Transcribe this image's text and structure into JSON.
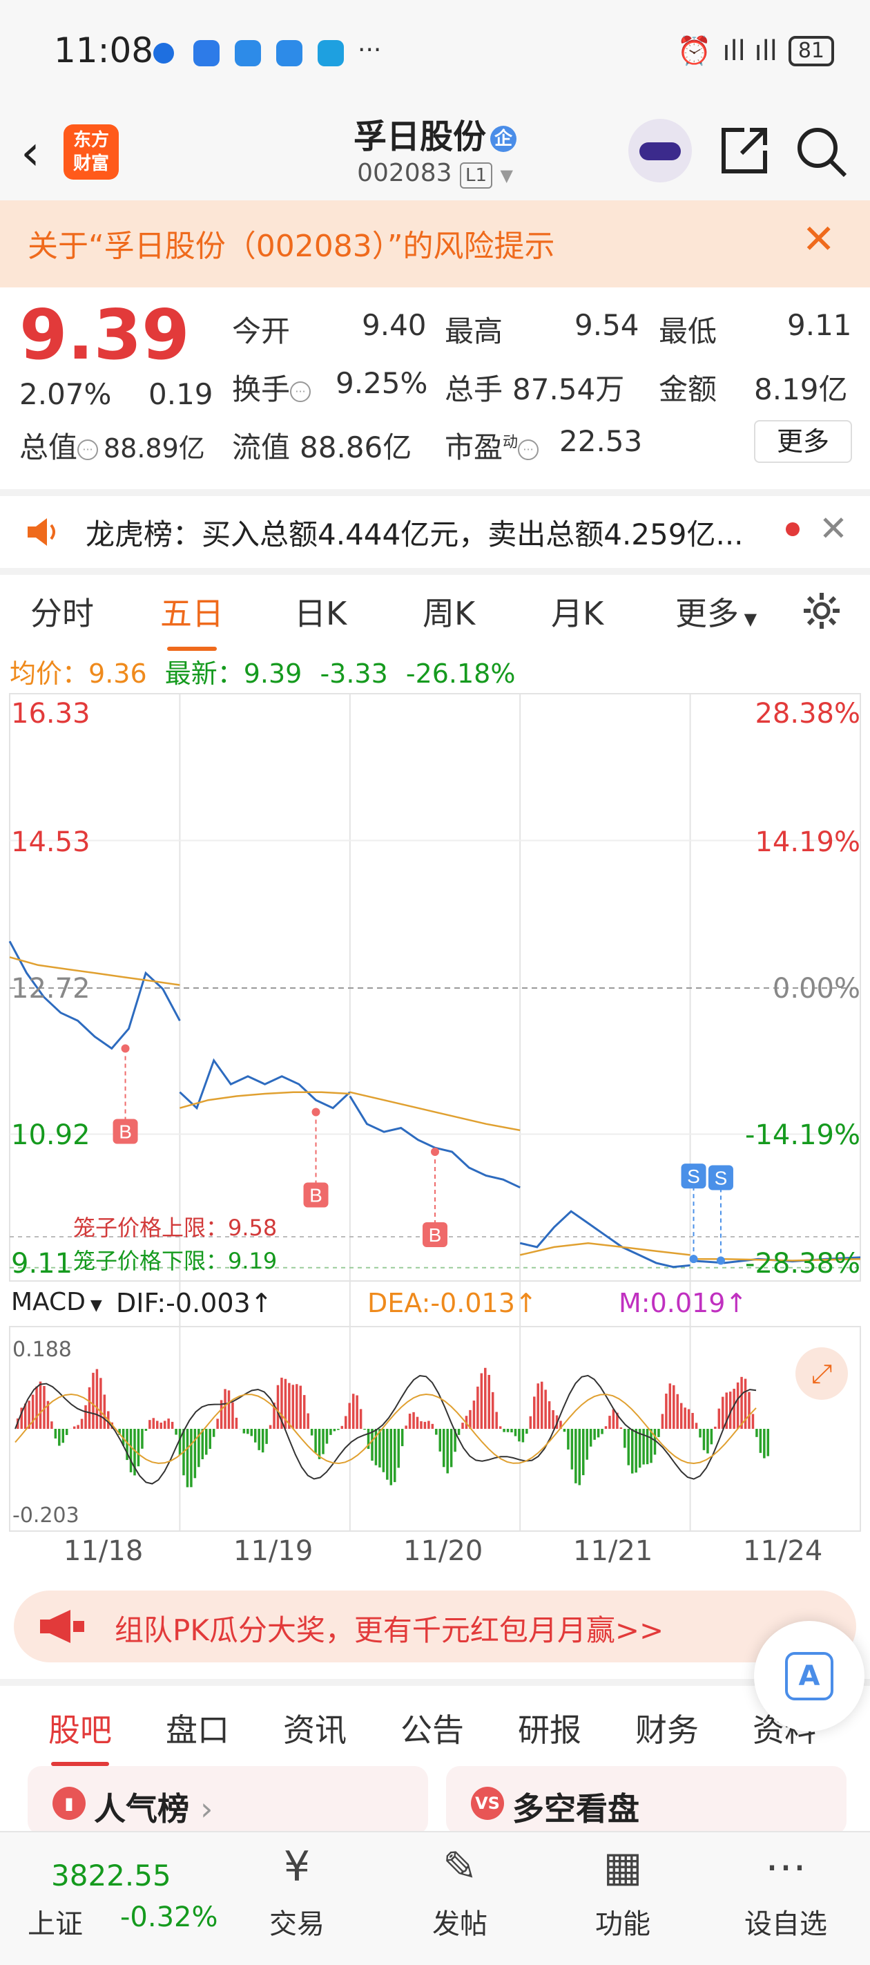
{
  "status": {
    "time": "11:08",
    "signal": "ıll ıll",
    "battery": "81",
    "more": "···"
  },
  "header": {
    "title": "孚日股份",
    "enterprise_badge": "企",
    "code": "002083",
    "level": "L1",
    "logo_line1": "东方",
    "logo_line2": "财富"
  },
  "risk": {
    "text": "关于“孚日股份（002083）”的风险提示"
  },
  "quote": {
    "price": "9.39",
    "change_pct": "2.07%",
    "change": "0.19",
    "open_label": "今开",
    "open": "9.40",
    "high_label": "最高",
    "high": "9.54",
    "low_label": "最低",
    "low": "9.11",
    "turnover_label": "换手",
    "turnover": "9.25%",
    "volume_label": "总手",
    "volume": "87.54万",
    "amount_label": "金额",
    "amount": "8.19亿",
    "mktcap_label": "总值",
    "mktcap": "88.89亿",
    "float_label": "流值",
    "float": "88.86亿",
    "pe_label": "市盈",
    "pe_sup": "动",
    "pe": "22.53",
    "more": "更多"
  },
  "dragon": {
    "text": "龙虎榜：买入总额4.444亿元，卖出总额4.259亿..."
  },
  "ktabs": [
    "分时",
    "五日",
    "日K",
    "周K",
    "月K",
    "更多"
  ],
  "info": {
    "avg_label": "均价：",
    "avg": "9.36",
    "latest_label": "最新：",
    "latest": "9.39",
    "chg": "-3.33",
    "chg_pct": "-26.18%"
  },
  "chart_data": {
    "type": "line",
    "left_axis": [
      "16.33",
      "14.53",
      "12.72",
      "10.92",
      "9.11"
    ],
    "right_axis": [
      "28.38%",
      "14.19%",
      "0.00%",
      "-14.19%",
      "-28.38%"
    ],
    "ylim": [
      9.11,
      16.33
    ],
    "x_labels": [
      "11/18",
      "11/19",
      "11/20",
      "11/21",
      "11/24"
    ],
    "cage_upper_label": "笼子价格上限：",
    "cage_upper": "9.58",
    "cage_lower_label": "笼子价格下限：",
    "cage_lower": "9.19",
    "markers": [
      {
        "type": "B",
        "day": 0,
        "frac": 0.68,
        "price": 11.95
      },
      {
        "type": "B",
        "day": 1,
        "frac": 0.8,
        "price": 11.15
      },
      {
        "type": "B",
        "day": 2,
        "frac": 0.5,
        "price": 10.65
      },
      {
        "type": "S",
        "day": 4,
        "frac": 0.02,
        "price": 9.3
      },
      {
        "type": "S",
        "day": 4,
        "frac": 0.18,
        "price": 9.28
      }
    ],
    "series": [
      {
        "day": 0,
        "price": [
          13.3,
          12.9,
          12.6,
          12.4,
          12.3,
          12.1,
          11.95,
          12.2,
          12.9,
          12.7,
          12.3
        ],
        "avg": [
          13.1,
          13.0,
          12.95,
          12.9,
          12.85,
          12.8,
          12.75
        ]
      },
      {
        "day": 1,
        "price": [
          11.4,
          11.2,
          11.8,
          11.5,
          11.6,
          11.5,
          11.6,
          11.5,
          11.3,
          11.2,
          11.4
        ],
        "avg": [
          11.2,
          11.3,
          11.35,
          11.38,
          11.4,
          11.4,
          11.38
        ]
      },
      {
        "day": 2,
        "price": [
          11.35,
          11.0,
          10.9,
          10.95,
          10.8,
          10.7,
          10.65,
          10.45,
          10.35,
          10.3,
          10.2
        ],
        "avg": [
          11.4,
          11.3,
          11.2,
          11.1,
          11.0,
          10.92
        ]
      },
      {
        "day": 3,
        "price": [
          9.5,
          9.45,
          9.7,
          9.9,
          9.75,
          9.6,
          9.45,
          9.35,
          9.25,
          9.2,
          9.22
        ],
        "avg": [
          9.35,
          9.45,
          9.5,
          9.45,
          9.4,
          9.35
        ]
      },
      {
        "day": 4,
        "price": [
          9.28,
          9.25,
          9.3,
          9.27,
          9.3,
          9.32
        ],
        "avg": [
          9.3,
          9.3,
          9.29,
          9.28,
          9.29,
          9.3
        ]
      }
    ]
  },
  "macd": {
    "label": "MACD",
    "dif": "DIF:-0.003↑",
    "dea": "DEA:-0.013↑",
    "m": "M:0.019↑",
    "top": "0.188",
    "bottom": "-0.203"
  },
  "promo": {
    "text": "组队PK瓜分大奖，更有千元红包月月赢>>"
  },
  "btabs": [
    "股吧",
    "盘口",
    "资讯",
    "公告",
    "研报",
    "财务",
    "资料"
  ],
  "cards": [
    {
      "title": "人气榜"
    },
    {
      "title": "多空看盘"
    }
  ],
  "bnav": {
    "index_value": "3822.55",
    "index_name": "上证",
    "index_pct": "-0.32%",
    "items": [
      "交易",
      "发帖",
      "功能",
      "设自选"
    ]
  }
}
